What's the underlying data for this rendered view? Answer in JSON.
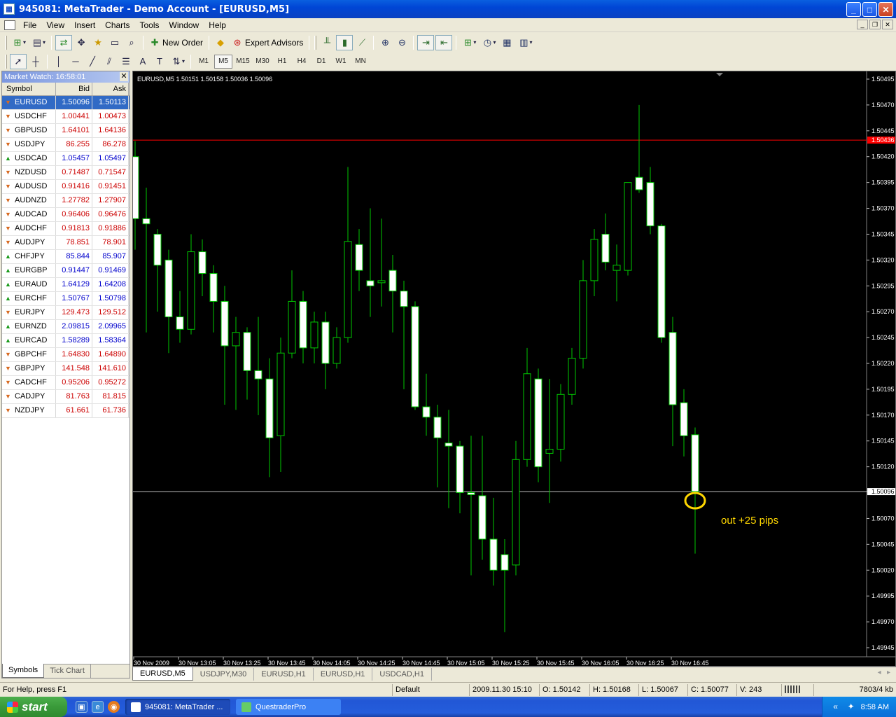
{
  "window": {
    "title": "945081: MetaTrader - Demo Account - [EURUSD,M5]"
  },
  "menu": [
    "File",
    "View",
    "Insert",
    "Charts",
    "Tools",
    "Window",
    "Help"
  ],
  "toolbar": {
    "new_order": "New Order",
    "expert_advisors": "Expert Advisors",
    "timeframes": [
      "M1",
      "M5",
      "M15",
      "M30",
      "H1",
      "H4",
      "D1",
      "W1",
      "MN"
    ],
    "active_timeframe": "M5"
  },
  "market_watch": {
    "title": "Market Watch: 16:58:01",
    "columns": [
      "Symbol",
      "Bid",
      "Ask"
    ],
    "rows": [
      {
        "symbol": "EURUSD",
        "bid": "1.50096",
        "ask": "1.50113",
        "dir": "down",
        "selected": true
      },
      {
        "symbol": "USDCHF",
        "bid": "1.00441",
        "ask": "1.00473",
        "dir": "down"
      },
      {
        "symbol": "GBPUSD",
        "bid": "1.64101",
        "ask": "1.64136",
        "dir": "down"
      },
      {
        "symbol": "USDJPY",
        "bid": "86.255",
        "ask": "86.278",
        "dir": "down"
      },
      {
        "symbol": "USDCAD",
        "bid": "1.05457",
        "ask": "1.05497",
        "dir": "up"
      },
      {
        "symbol": "NZDUSD",
        "bid": "0.71487",
        "ask": "0.71547",
        "dir": "down"
      },
      {
        "symbol": "AUDUSD",
        "bid": "0.91416",
        "ask": "0.91451",
        "dir": "down"
      },
      {
        "symbol": "AUDNZD",
        "bid": "1.27782",
        "ask": "1.27907",
        "dir": "down"
      },
      {
        "symbol": "AUDCAD",
        "bid": "0.96406",
        "ask": "0.96476",
        "dir": "down"
      },
      {
        "symbol": "AUDCHF",
        "bid": "0.91813",
        "ask": "0.91886",
        "dir": "down"
      },
      {
        "symbol": "AUDJPY",
        "bid": "78.851",
        "ask": "78.901",
        "dir": "down"
      },
      {
        "symbol": "CHFJPY",
        "bid": "85.844",
        "ask": "85.907",
        "dir": "up"
      },
      {
        "symbol": "EURGBP",
        "bid": "0.91447",
        "ask": "0.91469",
        "dir": "up"
      },
      {
        "symbol": "EURAUD",
        "bid": "1.64129",
        "ask": "1.64208",
        "dir": "up"
      },
      {
        "symbol": "EURCHF",
        "bid": "1.50767",
        "ask": "1.50798",
        "dir": "up"
      },
      {
        "symbol": "EURJPY",
        "bid": "129.473",
        "ask": "129.512",
        "dir": "down"
      },
      {
        "symbol": "EURNZD",
        "bid": "2.09815",
        "ask": "2.09965",
        "dir": "up"
      },
      {
        "symbol": "EURCAD",
        "bid": "1.58289",
        "ask": "1.58364",
        "dir": "up"
      },
      {
        "symbol": "GBPCHF",
        "bid": "1.64830",
        "ask": "1.64890",
        "dir": "down"
      },
      {
        "symbol": "GBPJPY",
        "bid": "141.548",
        "ask": "141.610",
        "dir": "down"
      },
      {
        "symbol": "CADCHF",
        "bid": "0.95206",
        "ask": "0.95272",
        "dir": "down"
      },
      {
        "symbol": "CADJPY",
        "bid": "81.763",
        "ask": "81.815",
        "dir": "down"
      },
      {
        "symbol": "NZDJPY",
        "bid": "61.661",
        "ask": "61.736",
        "dir": "down"
      }
    ],
    "tabs": [
      "Symbols",
      "Tick Chart"
    ],
    "active_tab": "Symbols"
  },
  "chart_tabs": [
    "EURUSD,M5",
    "USDJPY,M30",
    "EURUSD,H1",
    "EURUSD,H1",
    "USDCAD,H1"
  ],
  "status_bar": {
    "help": "For Help, press F1",
    "profile": "Default",
    "datetime": "2009.11.30 15:10",
    "open": "O: 1.50142",
    "high": "H: 1.50168",
    "low": "L: 1.50067",
    "close": "C: 1.50077",
    "volume": "V: 243",
    "traffic": "7803/4 kb"
  },
  "taskbar": {
    "start": "start",
    "tasks": [
      "945081: MetaTrader ...",
      "QuestraderPro"
    ],
    "clock": "8:58 AM"
  },
  "colors": {
    "selected_row": "#316ac5",
    "price_down": "#cc0000",
    "price_up": "#0000cc",
    "candle_wick": "#00c800",
    "bull_fill": "#000000",
    "bear_fill": "#ffffff",
    "annotation": "#ffd700",
    "ask_line": "#ff0000",
    "bid_line": "#c0c0c0"
  },
  "chart_data": {
    "type": "candlestick",
    "symbol_header": "EURUSD,M5  1.50151 1.50158 1.50036 1.50096",
    "ylim": [
      1.4994,
      1.505
    ],
    "y_ticks": [
      "1.50495",
      "1.50470",
      "1.50445",
      "1.50420",
      "1.50395",
      "1.50370",
      "1.50345",
      "1.50320",
      "1.50295",
      "1.50270",
      "1.50245",
      "1.50220",
      "1.50195",
      "1.50170",
      "1.50145",
      "1.50120",
      "1.50096",
      "1.50070",
      "1.50045",
      "1.50020",
      "1.49995",
      "1.49970",
      "1.49945"
    ],
    "x_ticks": [
      "30 Nov 2009",
      "30 Nov 13:05",
      "30 Nov 13:25",
      "30 Nov 13:45",
      "30 Nov 14:05",
      "30 Nov 14:25",
      "30 Nov 14:45",
      "30 Nov 15:05",
      "30 Nov 15:25",
      "30 Nov 15:45",
      "30 Nov 16:05",
      "30 Nov 16:25",
      "30 Nov 16:45"
    ],
    "bid_price": 1.50096,
    "ask_price": 1.50436,
    "ask_label": "1.50436",
    "bid_label": "1.50096",
    "annotation": "out +25 pips",
    "candles": [
      {
        "o": 1.5042,
        "h": 1.50435,
        "l": 1.5033,
        "c": 1.5036
      },
      {
        "o": 1.5036,
        "h": 1.5039,
        "l": 1.5025,
        "c": 1.50355
      },
      {
        "o": 1.50345,
        "h": 1.5035,
        "l": 1.5027,
        "c": 1.50315
      },
      {
        "o": 1.5032,
        "h": 1.5033,
        "l": 1.5023,
        "c": 1.50265
      },
      {
        "o": 1.50265,
        "h": 1.5029,
        "l": 1.5024,
        "c": 1.50253
      },
      {
        "o": 1.50253,
        "h": 1.50345,
        "l": 1.50248,
        "c": 1.50328
      },
      {
        "o": 1.50328,
        "h": 1.5034,
        "l": 1.50285,
        "c": 1.50307
      },
      {
        "o": 1.50307,
        "h": 1.50315,
        "l": 1.5025,
        "c": 1.5028
      },
      {
        "o": 1.5028,
        "h": 1.50295,
        "l": 1.5018,
        "c": 1.50237
      },
      {
        "o": 1.50237,
        "h": 1.50265,
        "l": 1.50175,
        "c": 1.5025
      },
      {
        "o": 1.5025,
        "h": 1.50255,
        "l": 1.50185,
        "c": 1.50213
      },
      {
        "o": 1.50213,
        "h": 1.50265,
        "l": 1.5017,
        "c": 1.50205
      },
      {
        "o": 1.50205,
        "h": 1.50225,
        "l": 1.5011,
        "c": 1.50148
      },
      {
        "o": 1.5015,
        "h": 1.50245,
        "l": 1.50115,
        "c": 1.5023
      },
      {
        "o": 1.5023,
        "h": 1.5031,
        "l": 1.50225,
        "c": 1.5028
      },
      {
        "o": 1.5028,
        "h": 1.5029,
        "l": 1.5022,
        "c": 1.50235
      },
      {
        "o": 1.50235,
        "h": 1.5027,
        "l": 1.5022,
        "c": 1.5026
      },
      {
        "o": 1.5026,
        "h": 1.5027,
        "l": 1.50195,
        "c": 1.5022
      },
      {
        "o": 1.5022,
        "h": 1.50255,
        "l": 1.50215,
        "c": 1.50245
      },
      {
        "o": 1.50245,
        "h": 1.5041,
        "l": 1.5024,
        "c": 1.50338
      },
      {
        "o": 1.50335,
        "h": 1.5035,
        "l": 1.5029,
        "c": 1.5031
      },
      {
        "o": 1.503,
        "h": 1.5037,
        "l": 1.50265,
        "c": 1.50295
      },
      {
        "o": 1.50298,
        "h": 1.5036,
        "l": 1.50275,
        "c": 1.503
      },
      {
        "o": 1.5031,
        "h": 1.50325,
        "l": 1.5025,
        "c": 1.5029
      },
      {
        "o": 1.5029,
        "h": 1.503,
        "l": 1.50195,
        "c": 1.50275
      },
      {
        "o": 1.50275,
        "h": 1.5028,
        "l": 1.50175,
        "c": 1.50178
      },
      {
        "o": 1.50178,
        "h": 1.5021,
        "l": 1.5015,
        "c": 1.50168
      },
      {
        "o": 1.50168,
        "h": 1.5018,
        "l": 1.501,
        "c": 1.50148
      },
      {
        "o": 1.50143,
        "h": 1.50175,
        "l": 1.5008,
        "c": 1.5014
      },
      {
        "o": 1.5014,
        "h": 1.50145,
        "l": 1.50075,
        "c": 1.50095
      },
      {
        "o": 1.50095,
        "h": 1.5015,
        "l": 1.50015,
        "c": 1.50093
      },
      {
        "o": 1.50092,
        "h": 1.5015,
        "l": 1.5003,
        "c": 1.5005
      },
      {
        "o": 1.5005,
        "h": 1.5009,
        "l": 1.50005,
        "c": 1.5002
      },
      {
        "o": 1.50035,
        "h": 1.5005,
        "l": 1.4996,
        "c": 1.5002
      },
      {
        "o": 1.50025,
        "h": 1.50145,
        "l": 1.50015,
        "c": 1.50127
      },
      {
        "o": 1.50127,
        "h": 1.50235,
        "l": 1.5012,
        "c": 1.5021
      },
      {
        "o": 1.50205,
        "h": 1.50215,
        "l": 1.50105,
        "c": 1.5012
      },
      {
        "o": 1.50133,
        "h": 1.50205,
        "l": 1.50085,
        "c": 1.50137
      },
      {
        "o": 1.50137,
        "h": 1.502,
        "l": 1.50125,
        "c": 1.5019
      },
      {
        "o": 1.5019,
        "h": 1.50235,
        "l": 1.5018,
        "c": 1.50225
      },
      {
        "o": 1.50225,
        "h": 1.5032,
        "l": 1.50215,
        "c": 1.503
      },
      {
        "o": 1.503,
        "h": 1.5035,
        "l": 1.50285,
        "c": 1.5034
      },
      {
        "o": 1.50345,
        "h": 1.50365,
        "l": 1.5031,
        "c": 1.50318
      },
      {
        "o": 1.5031,
        "h": 1.50335,
        "l": 1.5028,
        "c": 1.50315
      },
      {
        "o": 1.5031,
        "h": 1.5038,
        "l": 1.50305,
        "c": 1.50395
      },
      {
        "o": 1.504,
        "h": 1.5047,
        "l": 1.50385,
        "c": 1.50388
      },
      {
        "o": 1.50395,
        "h": 1.5041,
        "l": 1.50345,
        "c": 1.50353
      },
      {
        "o": 1.50353,
        "h": 1.50355,
        "l": 1.5024,
        "c": 1.50245
      },
      {
        "o": 1.5025,
        "h": 1.50265,
        "l": 1.5014,
        "c": 1.5018
      },
      {
        "o": 1.50182,
        "h": 1.50195,
        "l": 1.5013,
        "c": 1.5015
      },
      {
        "o": 1.50151,
        "h": 1.50158,
        "l": 1.50036,
        "c": 1.50096
      }
    ]
  }
}
